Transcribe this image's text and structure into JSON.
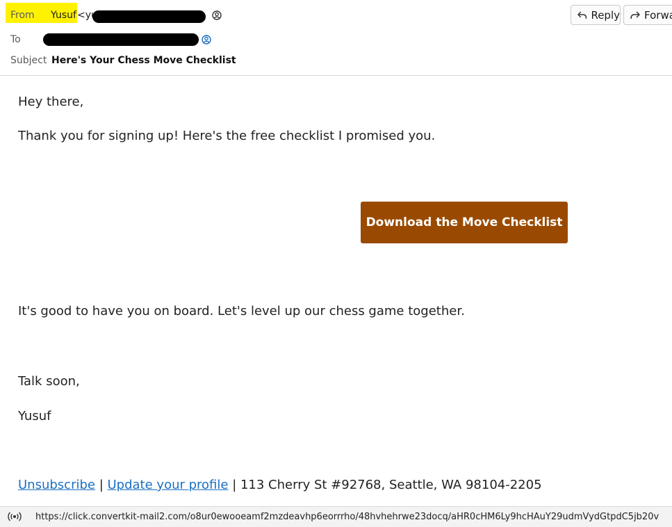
{
  "header": {
    "from_label": "From",
    "from_name": "Yusuf",
    "from_email_visible": "<yu",
    "to_label": "To",
    "subject_label": "Subject",
    "subject": "Here's Your Chess Move Checklist",
    "reply_label": "Reply",
    "forward_label": "Forwa",
    "highlight_color": "#fff200"
  },
  "body": {
    "greeting": "Hey there,",
    "thanks": "Thank you for signing up! Here's the free checklist I promised you.",
    "cta_label": "Download the Move Checklist",
    "cta_color": "#9a4a00",
    "onboard": "It's good to have you on board. Let's level up our chess game together.",
    "talk": "Talk soon,",
    "signoff": "Yusuf"
  },
  "footer": {
    "unsubscribe": "Unsubscribe",
    "sep1": " | ",
    "update_profile": "Update your profile",
    "address": " | 113 Cherry St #92768, Seattle, WA 98104-2205"
  },
  "status": {
    "url": "https://click.convertkit-mail2.com/o8ur0ewooeamf2mzdeavhp6eorrrho/48hvhehrwe23docq/aHR0cHM6Ly9hcHAuY29udmVydGtpdC5jb20v",
    "icon": "broadcast-icon"
  }
}
